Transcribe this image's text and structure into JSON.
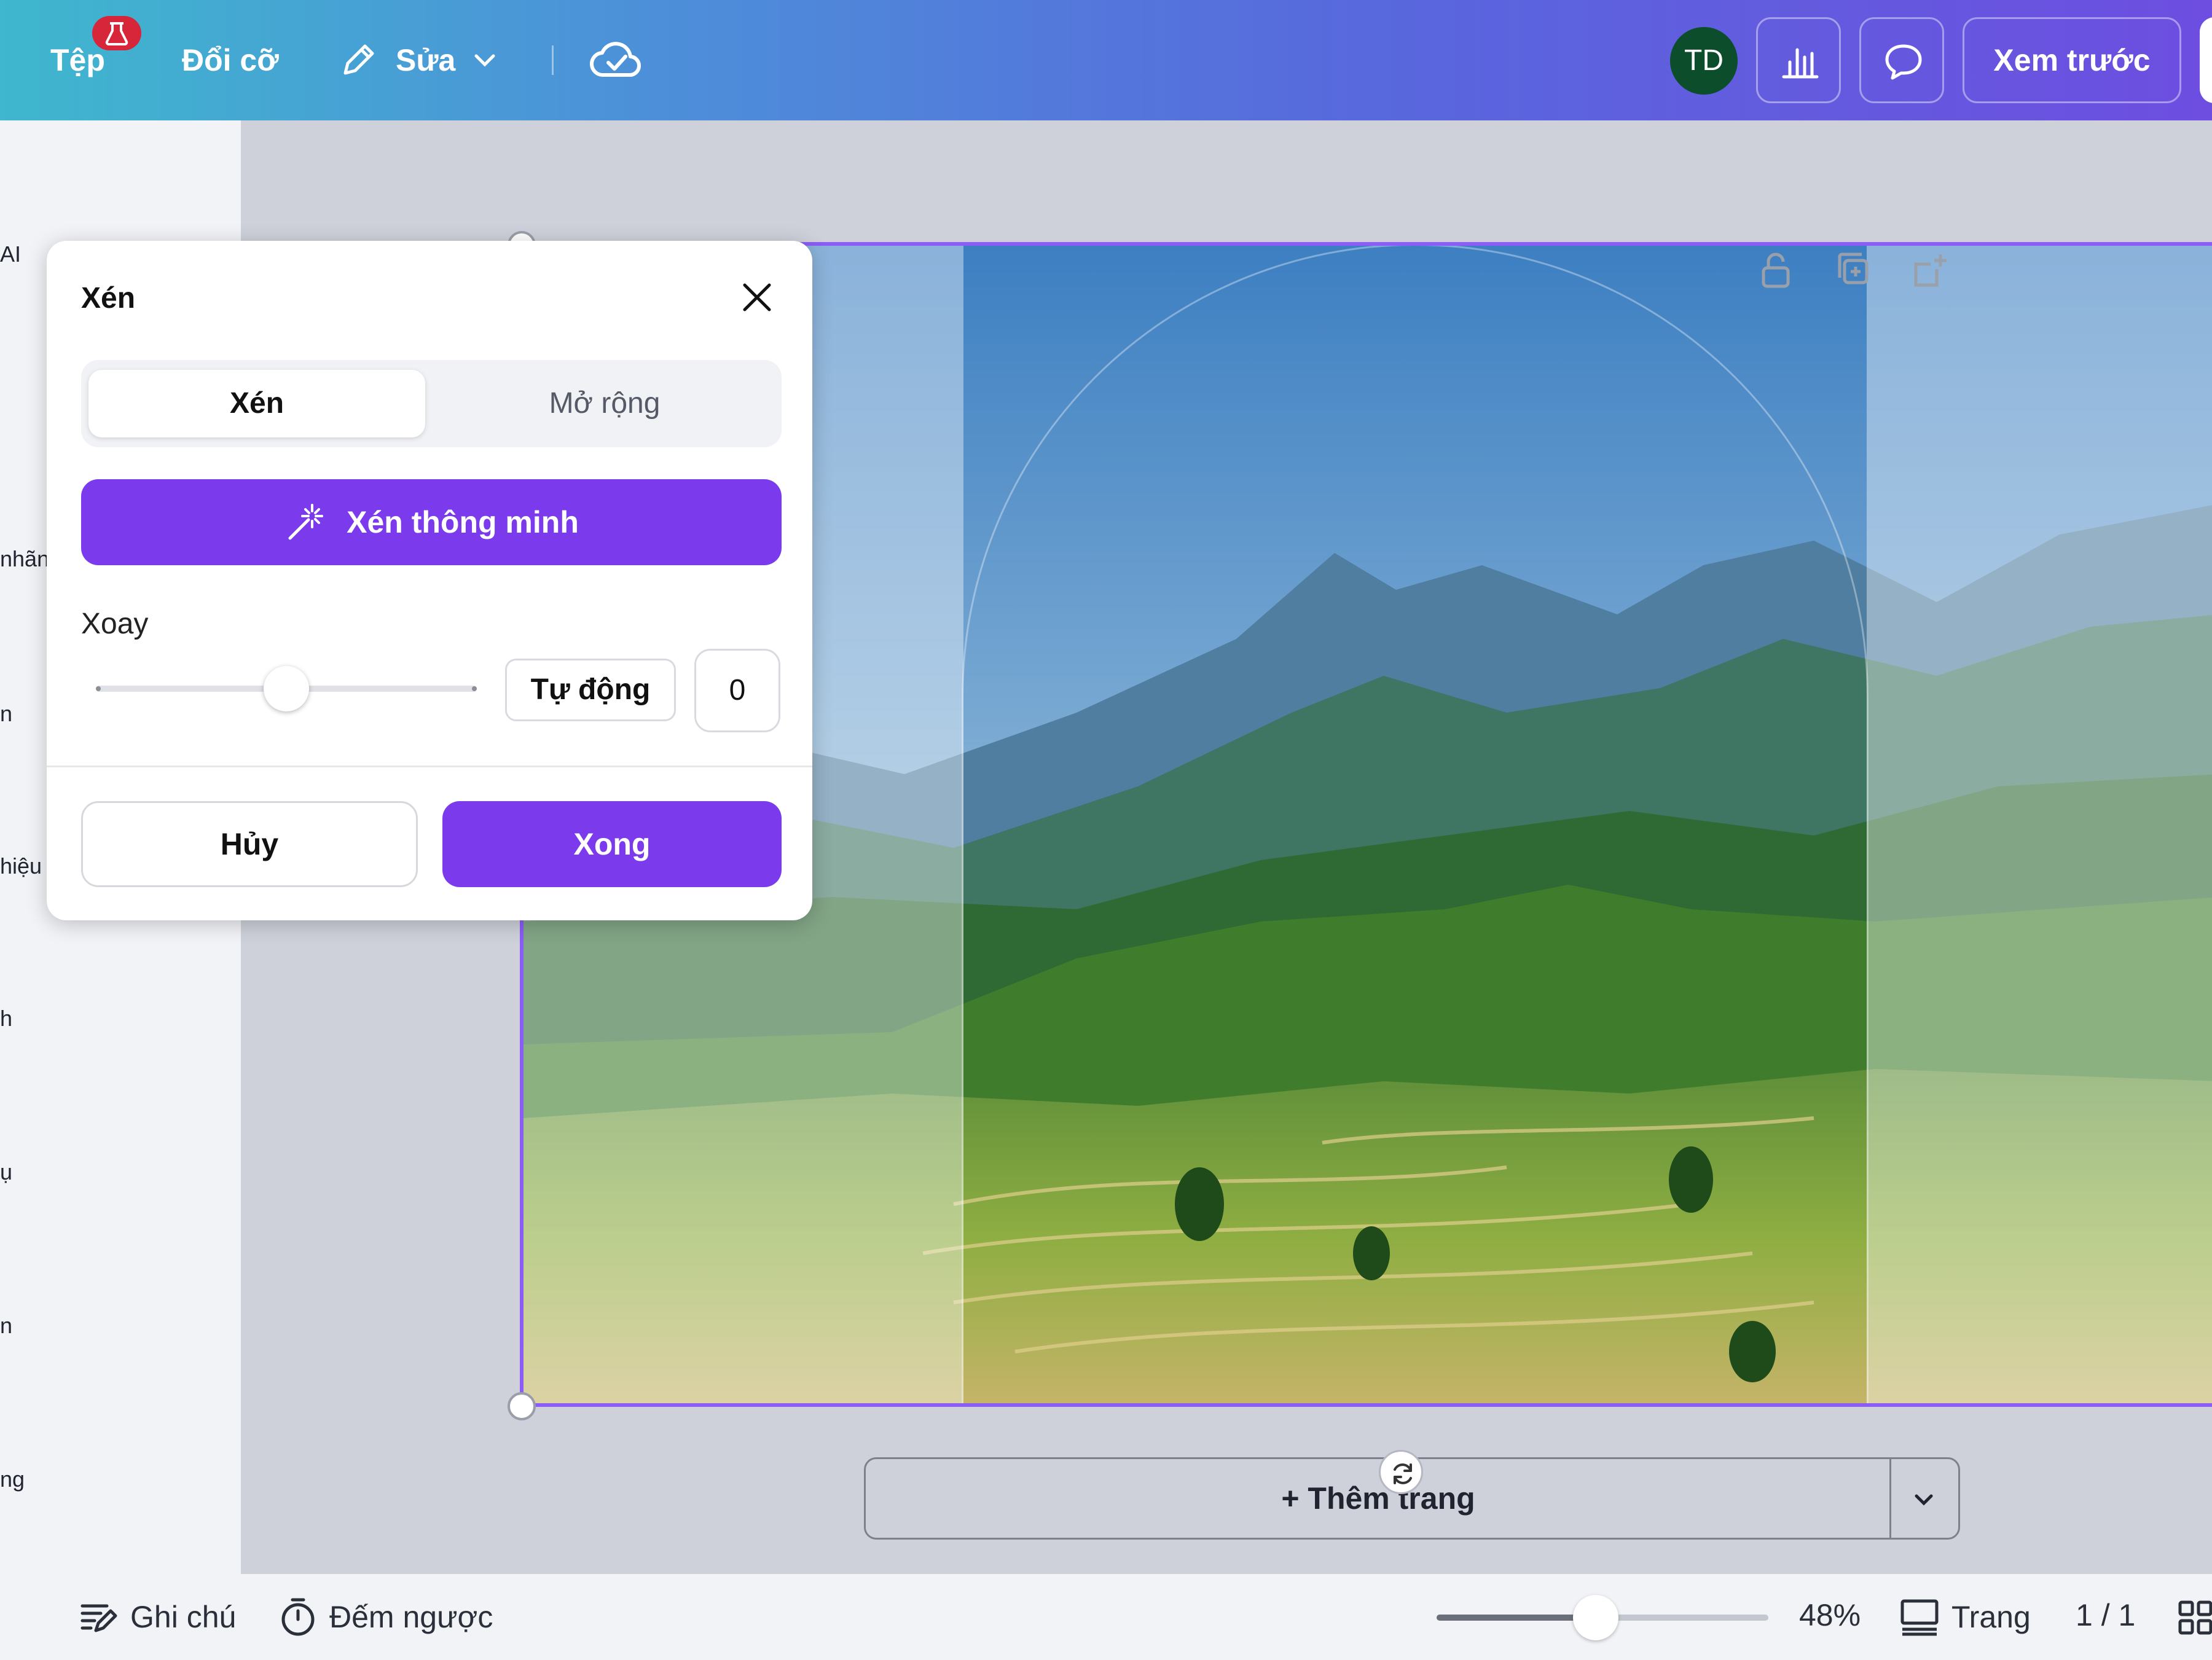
{
  "topbar": {
    "menu_file": "Tệp",
    "menu_resize": "Đổi cỡ",
    "menu_edit": "Sửa",
    "avatar_initials": "TD",
    "preview_label": "Xem trước",
    "icons": [
      "lab-badge-icon",
      "pencil-icon",
      "chevron-down-icon",
      "cloud-sync-icon",
      "chart-bar-icon",
      "comment-icon"
    ]
  },
  "side_panel": {
    "labels": [
      "AI",
      "nhãn",
      "n",
      "hiệu",
      "h",
      "ụ",
      "n",
      "ng"
    ]
  },
  "crop_dialog": {
    "title": "Xén",
    "tabs": [
      "Xén",
      "Mở rộng"
    ],
    "active_tab": "Xén",
    "smart_crop_label": "Xén thông minh",
    "rotate_label": "Xoay",
    "rotate_slider_fraction": 0.5,
    "auto_label": "Tự động",
    "rotate_value": "0",
    "cancel_label": "Hủy",
    "done_label": "Xong"
  },
  "canvas": {
    "add_page_label": "+ Thêm trang",
    "accent_color": "#8b5cf6",
    "icons": [
      "lock-icon",
      "duplicate-icon",
      "add-page-icon",
      "rotate-handle-icon"
    ]
  },
  "bottombar": {
    "notes_label": "Ghi chú",
    "timer_label": "Đếm ngược",
    "zoom_fraction": 0.48,
    "zoom_label": "48%",
    "pages_label": "Trang",
    "page_count": "1 / 1"
  }
}
